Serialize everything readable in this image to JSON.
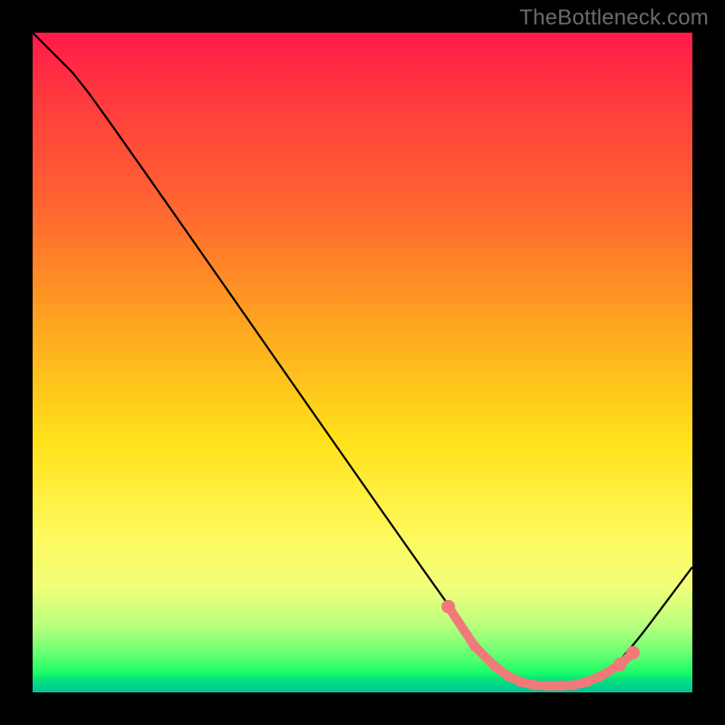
{
  "attribution": "TheBottleneck.com",
  "chart_data": {
    "type": "line",
    "title": "",
    "xlabel": "",
    "ylabel": "",
    "xlim": [
      0,
      100
    ],
    "ylim": [
      0,
      100
    ],
    "curve": [
      {
        "x": 0,
        "y": 100
      },
      {
        "x": 6,
        "y": 94
      },
      {
        "x": 10,
        "y": 89
      },
      {
        "x": 63,
        "y": 13
      },
      {
        "x": 70,
        "y": 4
      },
      {
        "x": 76,
        "y": 1
      },
      {
        "x": 83,
        "y": 1
      },
      {
        "x": 88,
        "y": 3
      },
      {
        "x": 100,
        "y": 19
      }
    ],
    "highlight_points": [
      {
        "x": 63,
        "y": 13
      },
      {
        "x": 67,
        "y": 7
      },
      {
        "x": 70,
        "y": 4
      },
      {
        "x": 72,
        "y": 2.5
      },
      {
        "x": 74,
        "y": 1.6
      },
      {
        "x": 76,
        "y": 1.1
      },
      {
        "x": 78,
        "y": 1
      },
      {
        "x": 80,
        "y": 1
      },
      {
        "x": 82,
        "y": 1.1
      },
      {
        "x": 84,
        "y": 1.6
      },
      {
        "x": 86,
        "y": 2.4
      },
      {
        "x": 89,
        "y": 4.2
      },
      {
        "x": 91,
        "y": 6
      }
    ]
  },
  "colors": {
    "top": "#ff1a4b",
    "mid": "#ffe21a",
    "bottom": "#00c49b",
    "highlight": "#f07a7a",
    "curve": "#000000"
  }
}
